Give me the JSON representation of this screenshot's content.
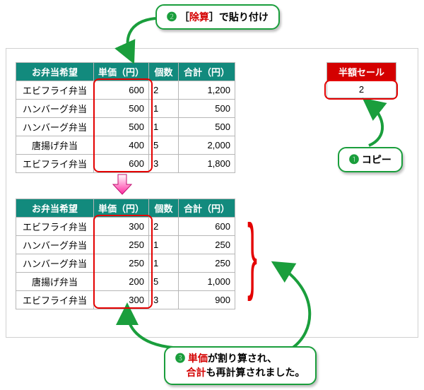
{
  "callouts": {
    "c2": {
      "num": "❷",
      "prefix": "［",
      "word": "除算",
      "suffix": "］で貼り付け"
    },
    "c1": {
      "num": "❶",
      "label": " コピー"
    },
    "c3": {
      "num": "❸",
      "line1a": " ",
      "line1red": "単価",
      "line1b": "が割り算され、",
      "line2red": "合計",
      "line2b": "も再計算されました。"
    }
  },
  "sale": {
    "header": "半額セール",
    "value": "2"
  },
  "headers": {
    "name": "お弁当希望",
    "price": "単価（円）",
    "qty": "個数",
    "total": "合計（円）"
  },
  "table1": [
    {
      "name": "エビフライ弁当",
      "price": "600",
      "qty": "2",
      "total": "1,200"
    },
    {
      "name": "ハンバーグ弁当",
      "price": "500",
      "qty": "1",
      "total": "500"
    },
    {
      "name": "ハンバーグ弁当",
      "price": "500",
      "qty": "1",
      "total": "500"
    },
    {
      "name": "唐揚げ弁当",
      "price": "400",
      "qty": "5",
      "total": "2,000"
    },
    {
      "name": "エビフライ弁当",
      "price": "600",
      "qty": "3",
      "total": "1,800"
    }
  ],
  "table2": [
    {
      "name": "エビフライ弁当",
      "price": "300",
      "qty": "2",
      "total": "600"
    },
    {
      "name": "ハンバーグ弁当",
      "price": "250",
      "qty": "1",
      "total": "250"
    },
    {
      "name": "ハンバーグ弁当",
      "price": "250",
      "qty": "1",
      "total": "250"
    },
    {
      "name": "唐揚げ弁当",
      "price": "200",
      "qty": "5",
      "total": "1,000"
    },
    {
      "name": "エビフライ弁当",
      "price": "300",
      "qty": "3",
      "total": "900"
    }
  ]
}
